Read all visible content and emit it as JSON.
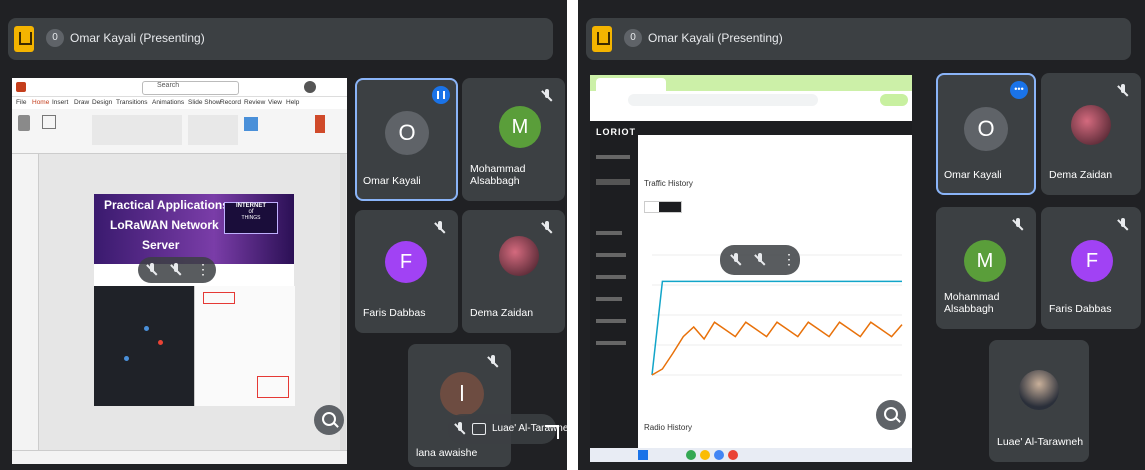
{
  "left": {
    "presenting_badge": "0",
    "presenting_title": "Omar Kayali (Presenting)",
    "participants": [
      {
        "name": "Omar Kayali",
        "initial": "O",
        "color": "#5f6368",
        "active": true
      },
      {
        "name": "Mohammad Alsabbagh",
        "initial": "M",
        "color": "#5a9e3a"
      },
      {
        "name": "Faris Dabbas",
        "initial": "F",
        "color": "#a142f4"
      },
      {
        "name": "Dema Zaidan"
      },
      {
        "name": "lana awaishe",
        "initial": "l",
        "color": "#6d4c41"
      }
    ],
    "floating_name": "Luae' Al-Tarawneh",
    "slide": {
      "title_line1": "Practical Applications",
      "title_line2": "LoRaWAN Network",
      "title_line3": "Server",
      "badge_line1": "INTERNET",
      "badge_line2": "of",
      "badge_line3": "THINGS"
    },
    "ppt": {
      "search_placeholder": "Search",
      "menu": [
        "File",
        "Home",
        "Insert",
        "Draw",
        "Design",
        "Transitions",
        "Animations",
        "Slide Show",
        "Record",
        "Review",
        "View",
        "Help"
      ]
    }
  },
  "right": {
    "presenting_badge": "0",
    "presenting_title": "Omar Kayali (Presenting)",
    "participants": [
      {
        "name": "Omar Kayali",
        "initial": "O",
        "color": "#5f6368",
        "active": true
      },
      {
        "name": "Dema Zaidan"
      },
      {
        "name": "Mohammad Alsabbagh",
        "initial": "M",
        "color": "#5a9e3a"
      },
      {
        "name": "Faris Dabbas",
        "initial": "F",
        "color": "#a142f4"
      },
      {
        "name": "Luae' Al-Tarawneh"
      }
    ],
    "browser": {
      "brand": "LORIOT",
      "section1": "Traffic History",
      "section2": "Radio History"
    }
  },
  "chart_data": {
    "type": "line",
    "title": "Traffic History",
    "series": [
      {
        "values": [
          0,
          78,
          78,
          78,
          78,
          78,
          78,
          78,
          78,
          78,
          78,
          78,
          78,
          78,
          78,
          78,
          78,
          78,
          78,
          78,
          78,
          78,
          78,
          78,
          78
        ]
      },
      {
        "values": [
          0,
          5,
          18,
          32,
          40,
          30,
          44,
          38,
          32,
          44,
          38,
          32,
          44,
          38,
          32,
          44,
          38,
          32,
          44,
          38,
          32,
          44,
          38,
          32,
          42
        ]
      }
    ],
    "colors": [
      "#12a5c9",
      "#e8710a"
    ],
    "ylim": [
      0,
      100
    ]
  }
}
